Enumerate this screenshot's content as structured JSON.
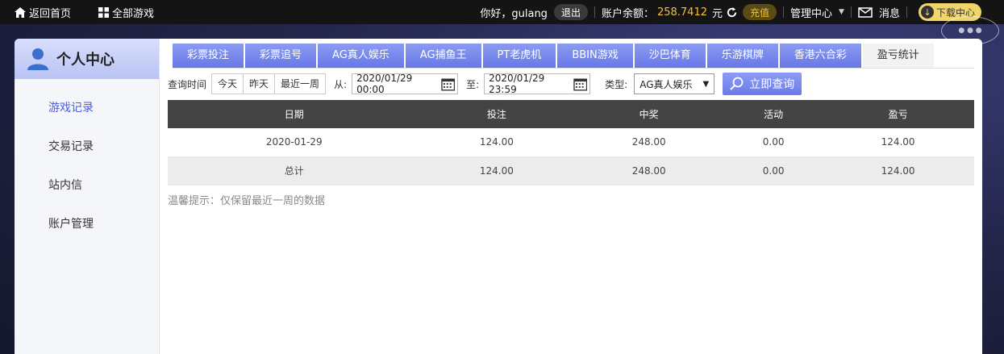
{
  "topbar": {
    "home": "返回首页",
    "all_games": "全部游戏",
    "greeting": "你好，gulang",
    "logout": "退出",
    "balance_label": "账户余额：",
    "balance_value": "258.7412",
    "balance_unit": "元",
    "recharge": "充值",
    "manage": "管理中心",
    "message": "消息",
    "download": "下载中心"
  },
  "sidebar": {
    "title": "个人中心",
    "items": [
      {
        "label": "游戏记录"
      },
      {
        "label": "交易记录"
      },
      {
        "label": "站内信"
      },
      {
        "label": "账户管理"
      }
    ]
  },
  "tabs": [
    {
      "label": "彩票投注"
    },
    {
      "label": "彩票追号"
    },
    {
      "label": "AG真人娱乐"
    },
    {
      "label": "AG捕鱼王"
    },
    {
      "label": "PT老虎机"
    },
    {
      "label": "BBIN游戏"
    },
    {
      "label": "沙巴体育"
    },
    {
      "label": "乐游棋牌"
    },
    {
      "label": "香港六合彩"
    },
    {
      "label": "盈亏统计"
    }
  ],
  "query": {
    "time_label": "查询时间",
    "today": "今天",
    "yesterday": "昨天",
    "last_week": "最近一周",
    "from_label": "从:",
    "from_value": "2020/01/29 00:00",
    "to_label": "至:",
    "to_value": "2020/01/29 23:59",
    "type_label": "类型:",
    "type_value": "AG真人娱乐",
    "submit": "立即查询"
  },
  "table": {
    "headers": [
      "日期",
      "投注",
      "中奖",
      "活动",
      "盈亏"
    ],
    "rows": [
      [
        "2020-01-29",
        "124.00",
        "248.00",
        "0.00",
        "124.00"
      ],
      [
        "总计",
        "124.00",
        "248.00",
        "0.00",
        "124.00"
      ]
    ]
  },
  "tip": "温馨提示：仅保留最近一周的数据",
  "colors": {
    "accent": "#6b7be8",
    "gold": "#f2c230",
    "header_dark": "#444444"
  }
}
